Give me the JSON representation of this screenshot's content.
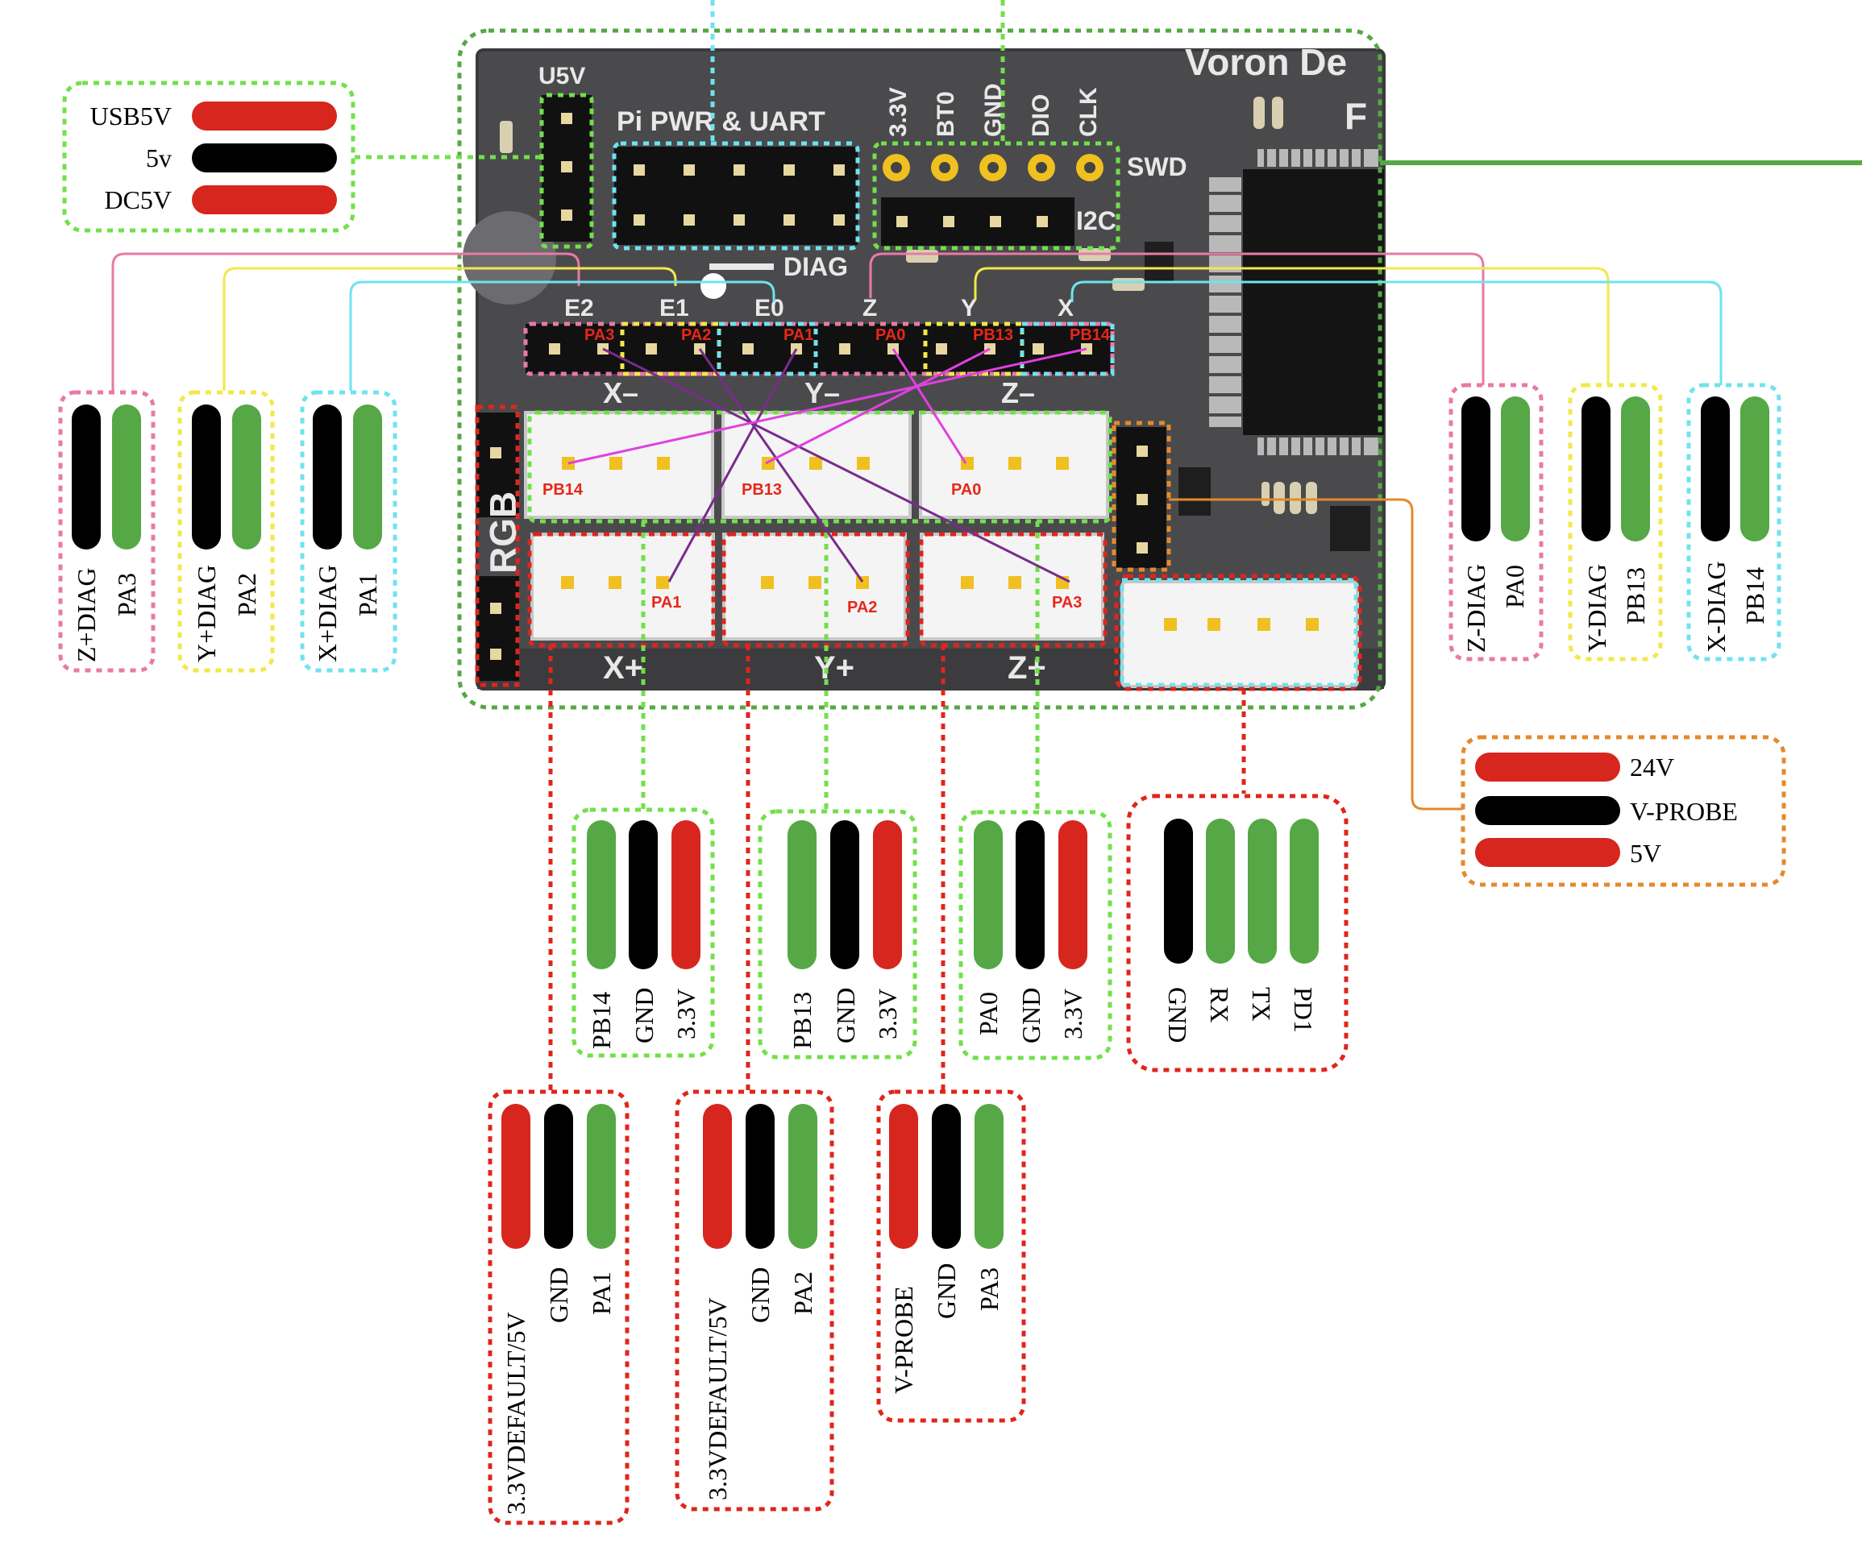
{
  "colors": {
    "green_dot": "#72e04a",
    "cyan_dot": "#6fe3ef",
    "red_dot": "#e0251b",
    "orange_dot": "#e48a2c",
    "pink_dot": "#e87aa8",
    "yellow_dot": "#f2e84a",
    "wire_red": "#d6261d",
    "wire_black": "#000000",
    "wire_green": "#55a845",
    "board": "#4a4a4d",
    "pin_gold": "#f0c020",
    "connector_white": "#f4f4f4"
  },
  "board": {
    "title": "Voron De",
    "title2": "F",
    "u5v": "U5V",
    "pi_pwr": "Pi PWR & UART",
    "swd": "SWD",
    "i2c": "I2C",
    "diag": "DIAG",
    "rgb": "RGB",
    "swd_pins": [
      "3.3V",
      "BT0",
      "GND",
      "DIO",
      "CLK"
    ],
    "diag_headers": [
      "E2",
      "E1",
      "E0",
      "Z",
      "Y",
      "X"
    ],
    "diag_pins": [
      "PA3",
      "PA2",
      "PA1",
      "PA0",
      "PB13",
      "PB14"
    ],
    "minus_labels": [
      "X–",
      "Y–",
      "Z–"
    ],
    "plus_labels": [
      "X+",
      "Y+",
      "Z+"
    ],
    "minus_conn_pins": [
      "PB14",
      "PB13",
      "PA0"
    ],
    "plus_conn_pins": [
      "PA1",
      "PA2",
      "PA3"
    ]
  },
  "power_select": {
    "labels": [
      "USB5V",
      "5v",
      "DC5V"
    ]
  },
  "left_diag": [
    {
      "labels": [
        "Z+DIAG",
        "PA3"
      ]
    },
    {
      "labels": [
        "Y+DIAG",
        "PA2"
      ]
    },
    {
      "labels": [
        "X+DIAG",
        "PA1"
      ]
    }
  ],
  "right_diag": [
    {
      "labels": [
        "Z-DIAG",
        "PA0"
      ]
    },
    {
      "labels": [
        "Y-DIAG",
        "PB13"
      ]
    },
    {
      "labels": [
        "X-DIAG",
        "PB14"
      ]
    }
  ],
  "probe": {
    "labels": [
      "24V",
      "V-PROBE",
      "5V"
    ]
  },
  "minus_endstops": [
    {
      "labels": [
        "PB14",
        "GND",
        "3.3V"
      ]
    },
    {
      "labels": [
        "PB13",
        "GND",
        "3.3V"
      ]
    },
    {
      "labels": [
        "PA0",
        "GND",
        "3.3V"
      ]
    }
  ],
  "uart": {
    "labels": [
      "GND",
      "RX",
      "TX",
      "PD1"
    ]
  },
  "plus_endstops": [
    {
      "labels": [
        "3.3VDEFAULT/5V",
        "GND",
        "PA1"
      ]
    },
    {
      "labels": [
        "3.3VDEFAULT/5V",
        "GND",
        "PA2"
      ]
    },
    {
      "labels": [
        "V-PROBE",
        "GND",
        "PA3"
      ]
    }
  ]
}
